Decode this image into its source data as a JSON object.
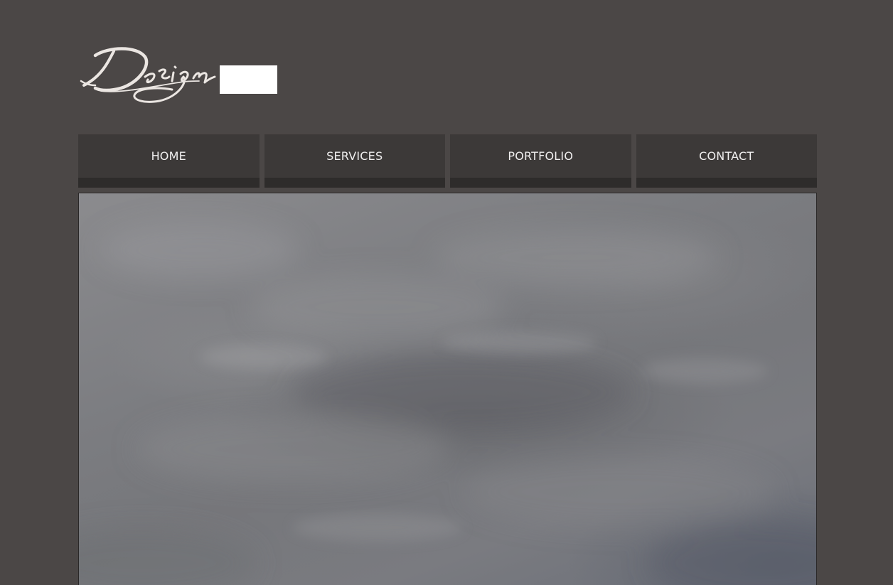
{
  "brand": {
    "logo_text": "Design"
  },
  "nav": {
    "items": [
      {
        "label": "HOME"
      },
      {
        "label": "SERVICES"
      },
      {
        "label": "PORTFOLIO"
      },
      {
        "label": "CONTACT"
      }
    ]
  },
  "colors": {
    "page_background": "#4b4746",
    "nav_background": "#3c3938",
    "nav_text": "#f0efef",
    "logo_stroke": "#ebe6e2"
  },
  "icons": {
    "logo": "handwritten-design-logo",
    "hero": "cloudy-sky-image"
  }
}
